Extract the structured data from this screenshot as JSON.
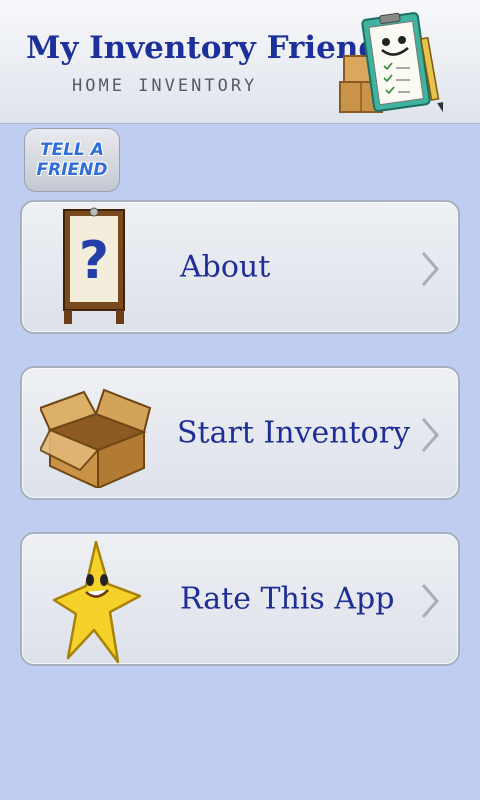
{
  "header": {
    "title": "My Inventory Friend",
    "subtitle": "HOME INVENTORY"
  },
  "tell_friend": {
    "line1": "TELL A",
    "line2": "FRIEND"
  },
  "menu": [
    {
      "label": "About",
      "icon": "question-sign-icon"
    },
    {
      "label": "Start Inventory",
      "icon": "cardboard-box-icon"
    },
    {
      "label": "Rate This App",
      "icon": "star-mascot-icon"
    }
  ],
  "colors": {
    "background": "#bfcef0",
    "title": "#1c2f9a",
    "label": "#1f2d96"
  }
}
